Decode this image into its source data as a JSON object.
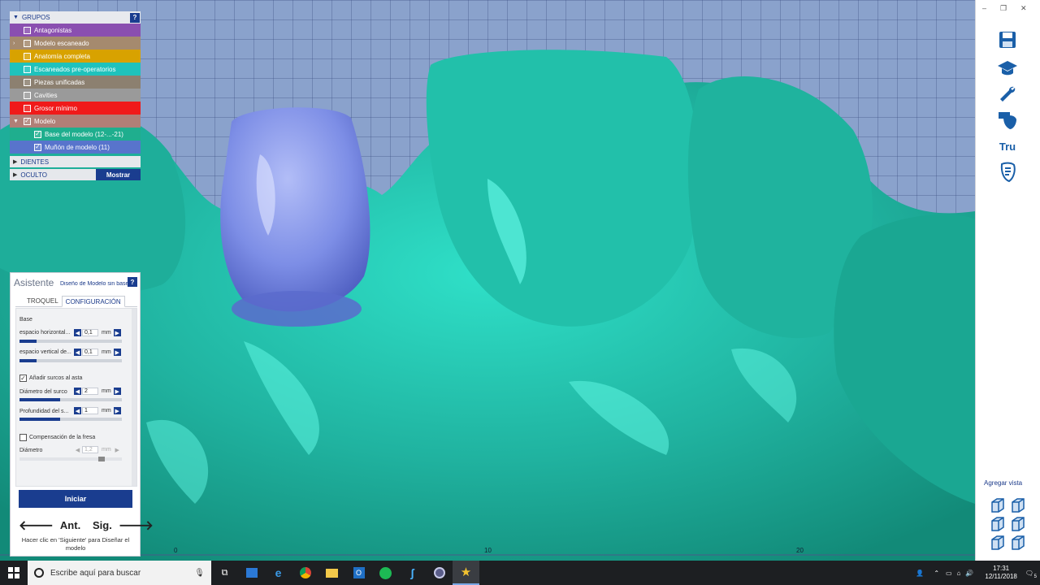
{
  "groups": {
    "header": "GRUPOS",
    "help": "?",
    "items": [
      {
        "label": "Antagonistas",
        "color": "#8a4fb0",
        "checked": false
      },
      {
        "label": "Modelo escaneado",
        "color": "#a58a6e",
        "checked": false
      },
      {
        "label": "Anatomía completa",
        "color": "#d8a200",
        "checked": false
      },
      {
        "label": "Escaneados pre-operatorios",
        "color": "#1fc2bc",
        "checked": false
      },
      {
        "label": "Piezas unificadas",
        "color": "#8c8070",
        "checked": false
      },
      {
        "label": "Cavities",
        "color": "#9a9a9a",
        "checked": false
      },
      {
        "label": "Grosor mínimo",
        "color": "#f01a1a",
        "checked": false
      },
      {
        "label": "Modelo",
        "color": "#b07f77",
        "checked": true
      },
      {
        "label": "Base del modelo (12-...-21)",
        "color": "#1fae8e",
        "checked": true,
        "sub": true
      },
      {
        "label": "Muñón de modelo (11)",
        "color": "#5874cc",
        "checked": true,
        "sub": true
      }
    ],
    "dientes": "DIENTES",
    "oculto": "OCULTO",
    "mostrar": "Mostrar"
  },
  "assistant": {
    "title": "Asistente",
    "subtitle": "Diseño de Modelo sin base",
    "help": "?",
    "tabs": [
      "TROQUEL",
      "CONFIGURACIÓN"
    ],
    "section_base": "Base",
    "params": [
      {
        "label": "espacio horizontal...",
        "value": "0,1",
        "unit": "mm",
        "level": 0.17
      },
      {
        "label": "espacio vertical de...",
        "value": "0,1",
        "unit": "mm",
        "level": 0.17
      },
      {
        "label": "Diámetro del surco",
        "value": "2",
        "unit": "mm",
        "level": 0.4
      },
      {
        "label": "Profundidad del s...",
        "value": "1",
        "unit": "mm",
        "level": 0.4
      }
    ],
    "add_grooves": "Añadir surcos al asta",
    "comp_fresa": "Compensación de la fresa",
    "diam_label": "Diámetro",
    "diam_value": "1,2",
    "diam_unit": "mm",
    "diam_level": 0.8,
    "start": "Iniciar",
    "prev": "Ant.",
    "next": "Sig.",
    "hint": "Hacer clic en 'Siguiente' para Diseñar el modelo"
  },
  "ruler": [
    "0",
    "10",
    "20"
  ],
  "right_toolbar": {
    "tru": "Tru",
    "add_view": "Agregar vista"
  },
  "taskbar": {
    "search_placeholder": "Escribe aquí para buscar",
    "time": "17:31",
    "date": "12/11/2018",
    "notif": "5"
  },
  "colors": {
    "model": "#24b5a0",
    "abutment": "#7d8ee6",
    "accent": "#1a3d8f"
  }
}
